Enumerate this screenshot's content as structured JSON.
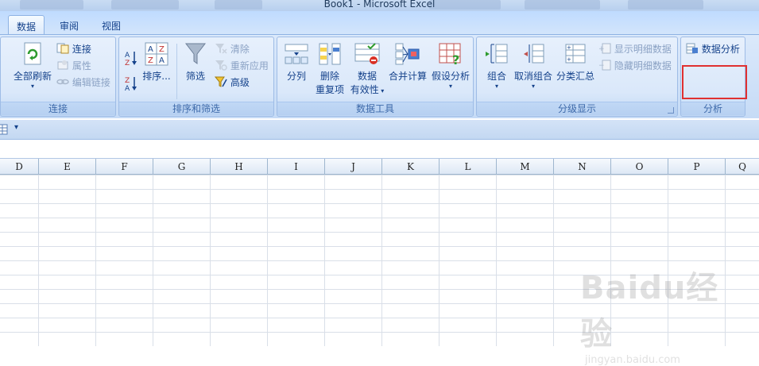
{
  "window": {
    "title": "Book1 - Microsoft Excel"
  },
  "tabs": [
    {
      "label": "数据"
    },
    {
      "label": "审阅"
    },
    {
      "label": "视图"
    }
  ],
  "groups": {
    "connections": {
      "label": "连接",
      "refresh_all": "全部刷新",
      "connect": "连接",
      "properties": "属性",
      "edit_links": "编辑链接"
    },
    "sort_filter": {
      "label": "排序和筛选",
      "sort": "排序...",
      "filter": "筛选",
      "clear": "清除",
      "reapply": "重新应用",
      "advanced": "高级"
    },
    "data_tools": {
      "label": "数据工具",
      "text_to_columns": "分列",
      "remove_dup_1": "删除",
      "remove_dup_2": "重复项",
      "validation_1": "数据",
      "validation_2": "有效性",
      "consolidate": "合并计算",
      "what_if": "假设分析"
    },
    "outline": {
      "label": "分级显示",
      "group": "组合",
      "ungroup": "取消组合",
      "subtotal": "分类汇总",
      "show_detail": "显示明细数据",
      "hide_detail": "隐藏明细数据"
    },
    "analysis": {
      "label": "分析",
      "data_analysis": "数据分析"
    }
  },
  "qat": {
    "dropdown": "▾"
  },
  "columns": [
    "D",
    "E",
    "F",
    "G",
    "H",
    "I",
    "J",
    "K",
    "L",
    "M",
    "N",
    "O",
    "P",
    "Q"
  ],
  "watermark": {
    "logo": "Baidu经验",
    "url": "jingyan.baidu.com"
  },
  "colors": {
    "highlight": "#e03030",
    "ribbon": "#dbe9fb"
  }
}
